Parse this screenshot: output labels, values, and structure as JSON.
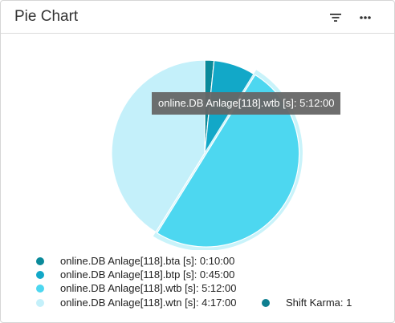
{
  "panel": {
    "title": "Pie Chart"
  },
  "header": {
    "filter_icon": "filter-icon",
    "more_icon": "more-horizontal-icon"
  },
  "tooltip": {
    "text": "online.DB Anlage[118].wtb [s]: 5:12:00"
  },
  "chart_data": {
    "type": "pie",
    "title": "",
    "unit": "seconds",
    "slices": [
      {
        "label": "online.DB Anlage[118].bta [s]: 0:10:00",
        "value": 600,
        "color": "#0a8a9a",
        "highlighted": false
      },
      {
        "label": "online.DB Anlage[118].btp [s]: 0:45:00",
        "value": 2700,
        "color": "#12a8c8",
        "highlighted": false
      },
      {
        "label": "online.DB Anlage[118].wtb [s]: 5:12:00",
        "value": 18720,
        "color": "#4dd7f0",
        "highlighted": true
      },
      {
        "label": "online.DB Anlage[118].wtn [s]: 4:17:00",
        "value": 15420,
        "color": "#c4f0fa",
        "highlighted": false
      }
    ],
    "legend_placement": "bottom"
  },
  "legend": {
    "shift_karma": {
      "label": "Shift Karma: 1",
      "color": "#0e7f90"
    }
  }
}
